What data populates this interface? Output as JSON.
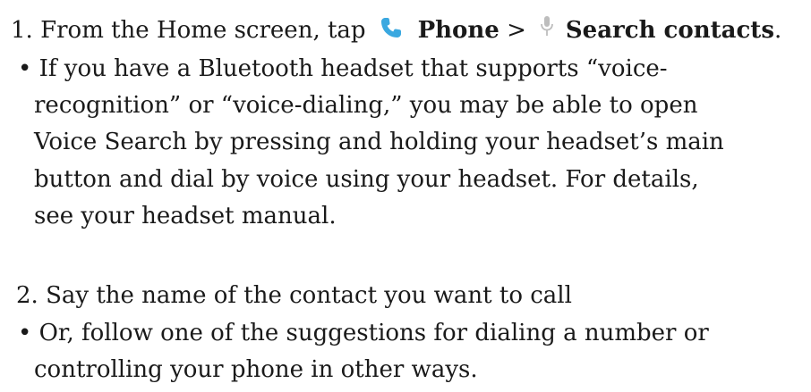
{
  "step1": {
    "prefix": "1. From the Home screen, tap",
    "phone_label": "Phone",
    "separator": ">",
    "search_label": "Search contacts",
    "end": "."
  },
  "bullet1": {
    "lines": [
      "• If you have a Bluetooth headset that supports “voice-",
      "recognition” or “voice-dialing,” you may be able to open",
      "Voice Search by pressing and holding your headset’s main",
      "button and dial by voice using your headset. For details,",
      "see your headset manual."
    ]
  },
  "step2": {
    "text": "2. Say the name of the contact you want to call"
  },
  "bullet2": {
    "lines": [
      "• Or, follow one of the suggestions for dialing a number or",
      "controlling your phone in other ways."
    ]
  },
  "icons": {
    "phone": "phone-icon",
    "mic": "microphone-icon",
    "phone_color": "#3aa8e0",
    "mic_color": "#bdbdbd"
  }
}
